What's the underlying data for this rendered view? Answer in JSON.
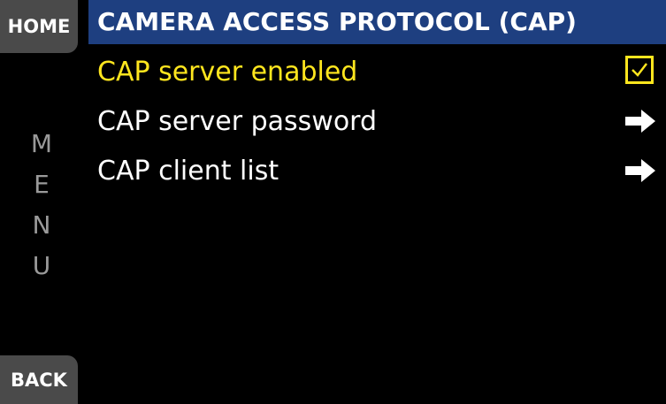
{
  "sidebar": {
    "home_label": "HOME",
    "menu_letters": [
      "M",
      "E",
      "N",
      "U"
    ],
    "back_label": "BACK"
  },
  "header": {
    "title": "CAMERA ACCESS PROTOCOL (CAP)"
  },
  "menu": {
    "items": [
      {
        "label": "CAP server enabled",
        "control": "checkbox",
        "checked": true,
        "selected": true
      },
      {
        "label": "CAP server password",
        "control": "arrow-right-icon",
        "selected": false
      },
      {
        "label": "CAP client list",
        "control": "arrow-right-icon",
        "selected": false
      }
    ]
  },
  "colors": {
    "title_bar": "#1e3f80",
    "highlight": "#ffe61e",
    "side_button": "#4a4a4a",
    "menu_letters": "#9a9a9a",
    "background": "#000000",
    "text": "#ffffff"
  }
}
